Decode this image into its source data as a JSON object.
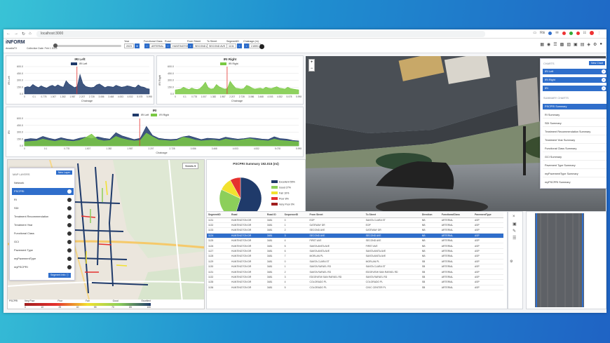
{
  "browser": {
    "url": "localhost:3000",
    "user_label": "Rix"
  },
  "app": {
    "logo": "iNFORM",
    "subtitle": "ArcadiaTX",
    "collection_date": "Collection Date: Feb 1 2023",
    "controls": [
      {
        "label": "Year",
        "value": "2023"
      },
      {
        "label": "Functional Class",
        "value": "ARTERIAL"
      },
      {
        "label": "Road",
        "value": "HUNTINGTON DR"
      },
      {
        "label": "From Street",
        "value": "SECOND AVE"
      },
      {
        "label": "To Street",
        "value": "SECOND AVE"
      },
      {
        "label": "SegmentID",
        "value": "1131"
      },
      {
        "label": "Chainage (m)",
        "value": "2.8991"
      }
    ]
  },
  "charts_iri_left": {
    "title": "IRI Left",
    "legend": "IRI Left",
    "xlabel": "Chainage",
    "ylabel": "IRI Left"
  },
  "charts_iri_right": {
    "title": "IRI Right",
    "legend": "IRI Right",
    "xlabel": "Chainage",
    "ylabel": "IRI Right"
  },
  "charts_iri": {
    "title": "IRI",
    "legend_left": "IRI Left",
    "legend_right": "IRI Right",
    "xlabel": "Chainage",
    "ylabel": "IRI"
  },
  "pie": {
    "title": "PSCPRI Summary 192.015 (mi)",
    "streets_label": "Streets"
  },
  "chart_data": [
    {
      "type": "area",
      "title": "IRI Left",
      "xlabel": "Chainage",
      "ylabel": "IRI Left",
      "ylim": [
        0,
        600
      ],
      "yticks": [
        "600.0",
        "450.0",
        "300.0",
        "150.0",
        "0.0"
      ],
      "xticks": [
        "0",
        "0.1",
        "0.778",
        "1.007",
        "1.382",
        "1.987",
        "2.207",
        "2.728",
        "3.086",
        "3.468",
        "4.003",
        "4.532",
        "5.078",
        "5.998"
      ],
      "series": [
        {
          "name": "IRI Left",
          "color": "#1f3a6a",
          "values": [
            140,
            160,
            150,
            210,
            170,
            140,
            180,
            150,
            130,
            170,
            190,
            160,
            200,
            170,
            150,
            290,
            220,
            180,
            140,
            170,
            430,
            230,
            170,
            150,
            140,
            150,
            200,
            220,
            180,
            140,
            170,
            160,
            150,
            190,
            170,
            150,
            160,
            180,
            170,
            150,
            140,
            200,
            160,
            150,
            120,
            110
          ]
        }
      ]
    },
    {
      "type": "area",
      "title": "IRI Right",
      "xlabel": "Chainage",
      "ylabel": "IRI Right",
      "ylim": [
        0,
        600
      ],
      "yticks": [
        "600.0",
        "450.0",
        "300.0",
        "150.0",
        "0.0"
      ],
      "xticks": [
        "0",
        "0.1",
        "0.778",
        "1.007",
        "1.382",
        "1.987",
        "2.207",
        "2.728",
        "3.086",
        "3.468",
        "4.003",
        "4.532",
        "5.078",
        "5.998"
      ],
      "series": [
        {
          "name": "IRI Right",
          "color": "#7ac943",
          "values": [
            90,
            100,
            110,
            150,
            120,
            100,
            130,
            110,
            100,
            120,
            180,
            260,
            140,
            110,
            120,
            210,
            160,
            130,
            110,
            120,
            280,
            200,
            130,
            120,
            110,
            120,
            190,
            170,
            130,
            110,
            120,
            130,
            110,
            150,
            130,
            120,
            140,
            160,
            130,
            120,
            110,
            150,
            120,
            110,
            100,
            90
          ]
        }
      ]
    },
    {
      "type": "area",
      "title": "IRI",
      "xlabel": "Chainage",
      "ylabel": "IRI",
      "ylim": [
        0,
        600
      ],
      "yticks": [
        "600.0",
        "450.0",
        "300.0",
        "150.0",
        "0.0"
      ],
      "xticks": [
        "0",
        "0.1",
        "0.778",
        "1.007",
        "1.382",
        "1.987",
        "2.207",
        "2.728",
        "3.086",
        "3.468",
        "4.003",
        "4.532",
        "5.078",
        "5.998"
      ],
      "series": [
        {
          "name": "IRI Left",
          "color": "#1f3a6a",
          "values": [
            140,
            160,
            150,
            210,
            170,
            140,
            180,
            150,
            130,
            170,
            190,
            160,
            200,
            170,
            150,
            290,
            220,
            180,
            140,
            170,
            430,
            230,
            170,
            150,
            140,
            150,
            200,
            220,
            180,
            140,
            170,
            160,
            150,
            190,
            170,
            150,
            160,
            180,
            170,
            150,
            140,
            200,
            160,
            150,
            120,
            110
          ]
        },
        {
          "name": "IRI Right",
          "color": "#7ac943",
          "values": [
            90,
            100,
            110,
            150,
            120,
            100,
            130,
            110,
            100,
            120,
            180,
            260,
            140,
            110,
            120,
            210,
            160,
            130,
            110,
            120,
            280,
            200,
            130,
            120,
            110,
            120,
            190,
            170,
            130,
            110,
            120,
            130,
            110,
            150,
            130,
            120,
            140,
            160,
            130,
            120,
            110,
            150,
            120,
            110,
            100,
            90
          ]
        }
      ]
    },
    {
      "type": "pie",
      "title": "PSCPRI Summary 192.015 (mi)",
      "series": [
        {
          "name": "PSCPRI",
          "values": [
            {
              "label": "Excellent 55%",
              "value": 55,
              "color": "#1f3a6a"
            },
            {
              "label": "Good 27%",
              "value": 27,
              "color": "#8ccf5a"
            },
            {
              "label": "Fair 10%",
              "value": 10,
              "color": "#f2e12e"
            },
            {
              "label": "Poor 8%",
              "value": 8,
              "color": "#e5312e"
            },
            {
              "label": "Very Poor 0%",
              "value": 0,
              "color": "#a01e1e"
            }
          ]
        }
      ]
    }
  ],
  "summary": {
    "charts_header": "CHARTS",
    "new_chart": "New Chart",
    "chart_buttons": [
      "IRI Left",
      "IRI Right",
      "IRI"
    ],
    "summary_header": "SUMMARY CHARTS",
    "items": [
      "PSCPRI Summary",
      "RI Summary",
      "SDI Summary",
      "Treatment Recommendation Summary",
      "Treatment Year Summary",
      "Functional Class Summary",
      "GCI Summary",
      "Pavement Type Summary",
      "myPavementType Summary",
      "myPSCPRI Summary"
    ]
  },
  "map_layers": {
    "header": "MAP LAYERS",
    "new_layer": "New Layer",
    "items": [
      "Network",
      "PSCPRI",
      "RI",
      "SDI",
      "Treatment Recommendation",
      "Treatment Year",
      "Functional Class",
      "GCI",
      "Pavement Type",
      "myPavementType",
      "myPSCPRI"
    ],
    "segment_info": "Segment Info",
    "popup_label": "PSCPRI LEGEND",
    "legend_title": "PSCPRI",
    "legend_labels": [
      "Very Poor",
      "Poor",
      "Fair",
      "Good",
      "Excellent"
    ],
    "legend_values": [
      "0",
      "10",
      "25",
      "40",
      "55",
      "70",
      "85",
      "100"
    ]
  },
  "table": {
    "columns": [
      "SegmentID",
      "Road",
      "Road ID",
      "SequenceID",
      "From Street",
      "To Street",
      "Direction",
      "FunctionalClass",
      "PavementType"
    ],
    "rows": [
      [
        "1131",
        "HUNTINGTON DR",
        "3481",
        "0",
        "EOP",
        "SANTA CLARA ST",
        "NB",
        "ARTERIAL",
        "ASP"
      ],
      [
        "1132",
        "HUNTINGTON DR",
        "3481",
        "1",
        "GATEWAY DR",
        "EOP",
        "NB",
        "ARTERIAL",
        "ASP"
      ],
      [
        "1133",
        "HUNTINGTON DR",
        "3481",
        "2",
        "SECOND AVE",
        "GATEWAY DR",
        "NB",
        "ARTERIAL",
        "ASP"
      ],
      [
        "1124",
        "HUNTINGTON DR",
        "3481",
        "3",
        "SECOND AVE",
        "SECOND AVE",
        "NB",
        "ARTERIAL",
        "ASP"
      ],
      [
        "1125",
        "HUNTINGTON DR",
        "3481",
        "4",
        "FIRST AVE",
        "SECOND AVE",
        "NB",
        "ARTERIAL",
        "ASP"
      ],
      [
        "1126",
        "HUNTINGTON DR",
        "3481",
        "5",
        "SANTA ANITA AVE",
        "FIRST AVE",
        "NB",
        "ARTERIAL",
        "ASP"
      ],
      [
        "1127",
        "HUNTINGTON DR",
        "3481",
        "6",
        "SANTA ANITA AVE",
        "SANTA ANITA AVE",
        "NB",
        "ARTERIAL",
        "ASP"
      ],
      [
        "1128",
        "HUNTINGTON DR",
        "3481",
        "7",
        "MORLAN PL",
        "SANTA ANITA AVE",
        "NB",
        "ARTERIAL",
        "ASP"
      ],
      [
        "1129",
        "HUNTINGTON DR",
        "3481",
        "0",
        "SANTA CLARA ST",
        "MORLAN PL",
        "SB",
        "ARTERIAL",
        "ASP"
      ],
      [
        "1130",
        "HUNTINGTON DR",
        "3481",
        "1",
        "SANTA RAFAEL RD",
        "SANTA CLARA ST",
        "SB",
        "ARTERIAL",
        "ASP"
      ],
      [
        "1131",
        "HUNTINGTON DR",
        "3481",
        "2",
        "SANTA RAFAEL RD",
        "EDGEVIEW SAN RAFAEL RD",
        "SB",
        "ARTERIAL",
        "ASP"
      ],
      [
        "1132",
        "HUNTINGTON DR",
        "3481",
        "3",
        "EDGEVIEW SAN RAFAEL RD",
        "SANTA RAFAEL RD",
        "SB",
        "ARTERIAL",
        "ASP"
      ],
      [
        "1135",
        "HUNTINGTON DR",
        "3481",
        "4",
        "COLORADO PL",
        "COLORADO PL",
        "SB",
        "ARTERIAL",
        "ASP"
      ],
      [
        "1136",
        "HUNTINGTON DR",
        "3481",
        "5",
        "COLORADO PL",
        "CIVIC CENTER PL",
        "SB",
        "ARTERIAL",
        "ASP"
      ]
    ],
    "selected_row": 3
  },
  "colors": {
    "accent": "#2f6ecb",
    "navy": "#1f3a6a",
    "green": "#7ac943"
  }
}
